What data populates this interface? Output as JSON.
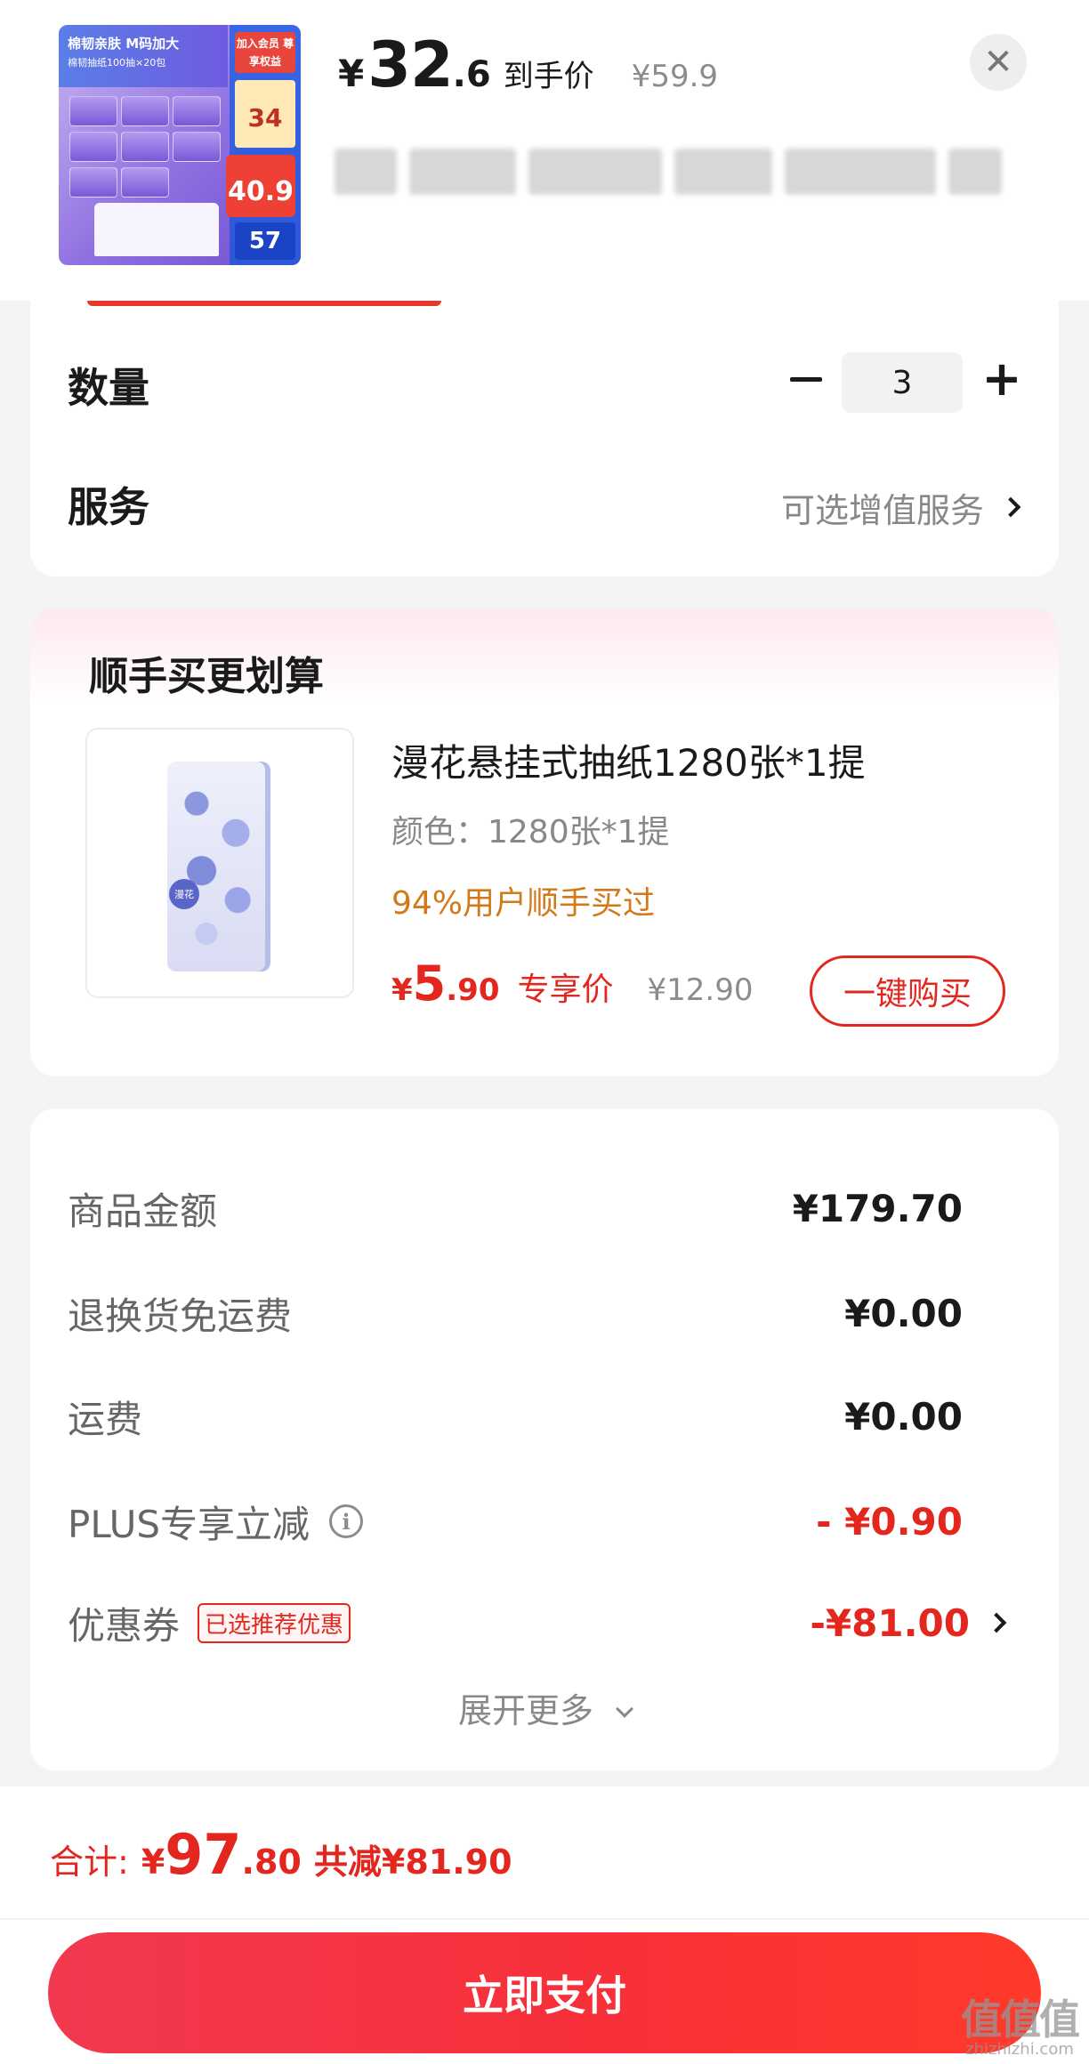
{
  "header": {
    "price_symbol": "¥",
    "price_integer": "32",
    "price_decimal": ".6",
    "price_tag": "到手价",
    "original_price": "¥59.9",
    "product_title_blurred": true,
    "thumbnail_texts": {
      "banner": "棉韧亲肤 M码加大",
      "banner_sub": "棉韧抽纸100抽×20包",
      "member": "加入会员 尊享权益",
      "badge_34": "34",
      "badge_409": "40.9",
      "badge_57": "57"
    }
  },
  "options": {
    "quantity_label": "数量",
    "quantity_value": "3",
    "service_label": "服务",
    "service_link": "可选增值服务"
  },
  "recommend": {
    "heading": "顺手买更划算",
    "product_name": "漫花悬挂式抽纸1280张*1提",
    "spec": "颜色：1280张*1提",
    "buyers_note": "94%用户顺手买过",
    "price_symbol": "¥",
    "price_integer": "5",
    "price_decimal": ".90",
    "exclusive_label": "专享价",
    "original_price": "¥12.90",
    "buy_button": "一键购买",
    "pack_label": "漫花"
  },
  "summary": {
    "rows": [
      {
        "label": "商品金额",
        "value": "¥179.70"
      },
      {
        "label": "退换货免运费",
        "value": "¥0.00"
      },
      {
        "label": "运费",
        "value": "¥0.00"
      },
      {
        "label": "PLUS专享立减",
        "value": "- ¥0.90"
      },
      {
        "label": "优惠券",
        "value": "-¥81.00",
        "badge": "已选推荐优惠"
      }
    ],
    "expand_more": "展开更多"
  },
  "footer": {
    "total_label": "合计:",
    "total_symbol": "¥",
    "total_integer": "97",
    "total_decimal": ".80",
    "total_saved": "共减¥81.90",
    "pay_button": "立即支付"
  },
  "watermark": {
    "logo": "值值值",
    "url": "zhizhizhi.com"
  },
  "colors": {
    "accent_red": "#e3271f",
    "buyers_orange": "#d27a1a",
    "pay_gradient_start": "#f2394f",
    "pay_gradient_end": "#ff3a2a"
  }
}
